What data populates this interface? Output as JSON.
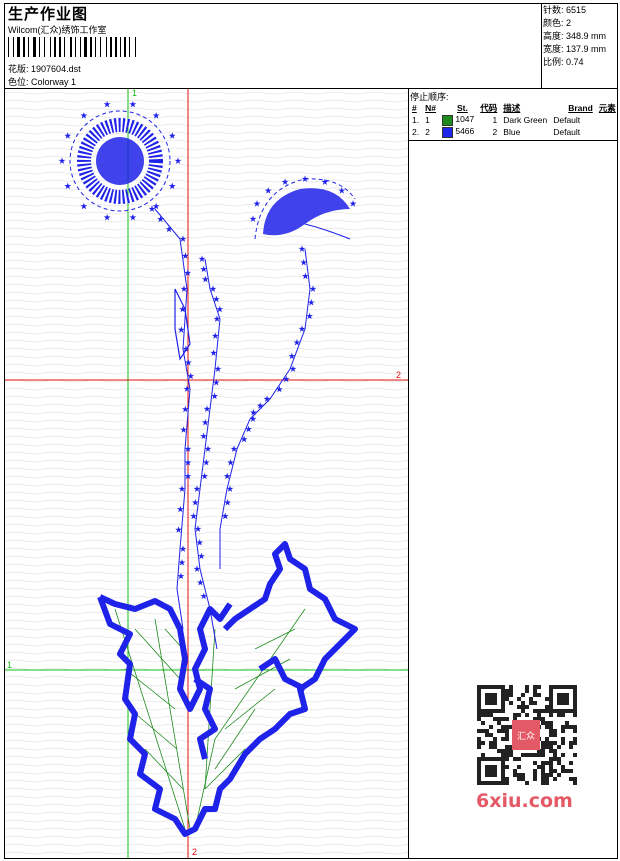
{
  "header": {
    "title": "生产作业图",
    "studio": "Wilcom(汇众)绣饰工作室",
    "pattern_label": "花版:",
    "pattern_value": "1907604.dst",
    "colorway_label": "色位:",
    "colorway_value": "Colorway 1"
  },
  "stats": {
    "stitches_label": "针数:",
    "stitches_value": "6515",
    "colors_label": "颜色:",
    "colors_value": "2",
    "height_label": "高度:",
    "height_value": "348.9 mm",
    "width_label": "宽度:",
    "width_value": "137.9 mm",
    "scale_label": "比例:",
    "scale_value": "0.74"
  },
  "stop_sequence": {
    "title": "停止顺序:",
    "headers": [
      "#",
      "N#",
      "St.",
      "代码",
      "描述",
      "Brand",
      "元素"
    ],
    "rows": [
      {
        "num": "1.",
        "n": "1",
        "color": "#1d8a1d",
        "stitches": "1047",
        "code": "1",
        "desc": "Dark Green",
        "brand": "Default"
      },
      {
        "num": "2.",
        "n": "2",
        "color": "#1f22e8",
        "stitches": "5466",
        "code": "2",
        "desc": "Blue",
        "brand": "Default"
      }
    ]
  },
  "axes": {
    "top_label": "1",
    "right_label": "2",
    "left_label": "1",
    "bottom_label": "2"
  },
  "watermark": {
    "text": "6xiu.com",
    "badge_text": "汇众"
  },
  "colors": {
    "thread_blue": "#1f22e8",
    "thread_green": "#1d8a1d",
    "axis_red": "#e01010",
    "axis_green": "#10c010"
  }
}
